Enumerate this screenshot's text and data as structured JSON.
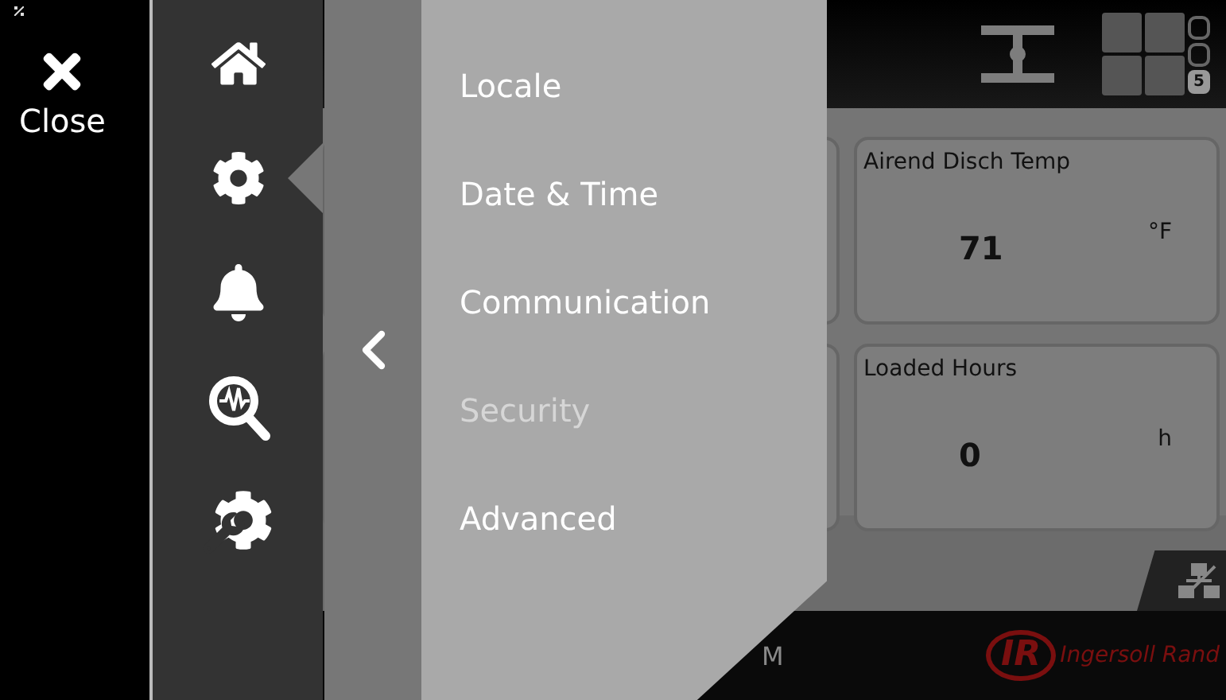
{
  "close": {
    "label": "Close"
  },
  "nav": [
    {
      "kind": "home",
      "selected": false
    },
    {
      "kind": "settings",
      "selected": true
    },
    {
      "kind": "alarms",
      "selected": false
    },
    {
      "kind": "diagnostics",
      "selected": false
    },
    {
      "kind": "service",
      "selected": false
    }
  ],
  "menu": {
    "items": [
      {
        "label": "Locale",
        "disabled": false
      },
      {
        "label": "Date & Time",
        "disabled": false
      },
      {
        "label": "Communication",
        "disabled": false
      },
      {
        "label": "Security",
        "disabled": true
      },
      {
        "label": "Advanced",
        "disabled": false
      }
    ]
  },
  "dashboard": {
    "page_badge": "5",
    "cards": [
      {
        "title": "Airend Disch Temp",
        "value": "71",
        "unit": "°F"
      },
      {
        "title": "Loaded Hours",
        "value": "0",
        "unit": "h"
      }
    ],
    "footer": {
      "text": "M",
      "brand_mark": "IR",
      "brand": "Ingersoll Rand"
    }
  }
}
